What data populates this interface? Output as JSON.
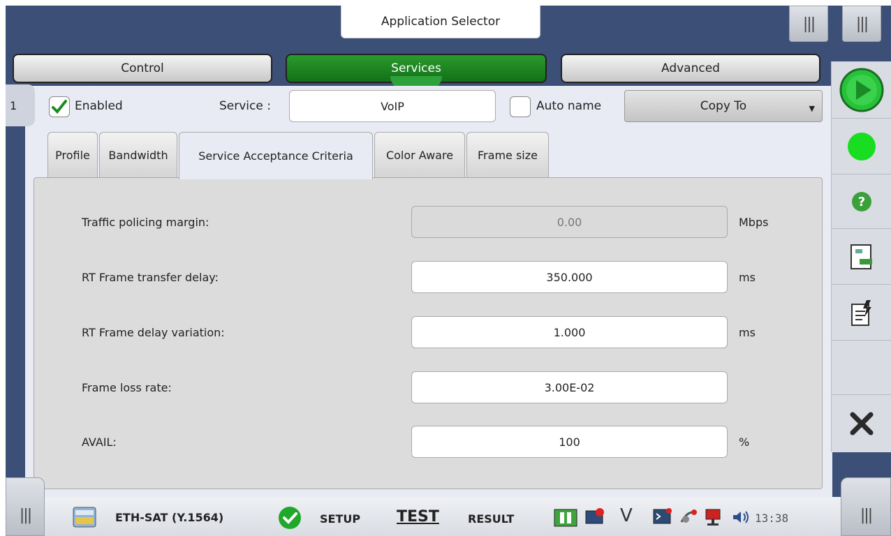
{
  "title": "Application Selector",
  "main_tabs": [
    {
      "label": "Control",
      "active": false
    },
    {
      "label": "Services",
      "active": true
    },
    {
      "label": "Advanced",
      "active": false
    }
  ],
  "side_number": "1",
  "header": {
    "enabled_label": "Enabled",
    "enabled_checked": true,
    "service_label": "Service :",
    "service_value": "VoIP",
    "auto_name_label": "Auto name",
    "auto_name_checked": false,
    "copy_to_label": "Copy To"
  },
  "sub_tabs": [
    {
      "label": "Profile"
    },
    {
      "label": "Bandwidth"
    },
    {
      "label": "Service Acceptance Criteria",
      "active": true
    },
    {
      "label": "Color Aware"
    },
    {
      "label": "Frame size"
    }
  ],
  "fields": [
    {
      "label": "Traffic policing margin:",
      "value": "0.00",
      "unit": "Mbps",
      "disabled": true
    },
    {
      "label": "RT Frame transfer delay:",
      "value": "350.000",
      "unit": "ms",
      "disabled": false
    },
    {
      "label": "RT Frame delay variation:",
      "value": "1.000",
      "unit": "ms",
      "disabled": false
    },
    {
      "label": "Frame loss rate:",
      "value": "3.00E-02",
      "unit": "",
      "disabled": false
    },
    {
      "label": "AVAIL:",
      "value": "100",
      "unit": "%",
      "disabled": false
    }
  ],
  "right_sidebar": [
    "play-icon",
    "status-led-icon",
    "help-icon",
    "report-icon",
    "script-icon",
    "close-icon"
  ],
  "bottom_bar": {
    "app_name": "ETH-SAT (Y.1564)",
    "setup_label": "SETUP",
    "test_label": "TEST",
    "result_label": "RESULT",
    "v_label": "V",
    "clock": "13:38"
  },
  "colors": {
    "accent_green": "#1d8a22",
    "background": "#3c4f77",
    "panel": "#e8ebf3"
  }
}
